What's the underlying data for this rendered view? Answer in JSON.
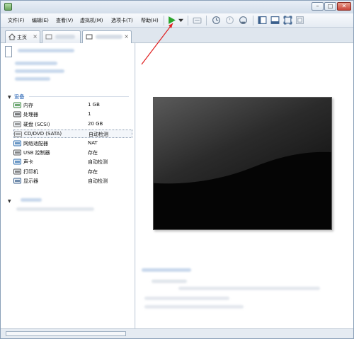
{
  "menu": {
    "items": [
      "文件(F)",
      "编辑(E)",
      "查看(V)",
      "虚拟机(M)",
      "选项卡(T)",
      "帮助(H)"
    ]
  },
  "toolbar": {
    "icons": [
      "play-icon",
      "dropdown-icon",
      "send-keys-icon",
      "snapshot-icon",
      "revert-snapshot-icon",
      "snapshot-manager-icon",
      "console-view-icon",
      "full-screen-icon",
      "unity-icon",
      "fit-window-icon"
    ]
  },
  "tabs": [
    {
      "label": "主页",
      "icon": "home-icon"
    }
  ],
  "devices": {
    "section_title": "设备",
    "items": [
      {
        "name": "内存",
        "value": "1 GB",
        "icon": "memory-icon"
      },
      {
        "name": "处理器",
        "value": "1",
        "icon": "processor-icon"
      },
      {
        "name": "硬盘 (SCSI)",
        "value": "20 GB",
        "icon": "hard-disk-icon"
      },
      {
        "name": "CD/DVD (SATA)",
        "value": "自动检测",
        "icon": "cd-dvd-icon"
      },
      {
        "name": "网络适配器",
        "value": "NAT",
        "icon": "network-adapter-icon"
      },
      {
        "name": "USB 控制器",
        "value": "存在",
        "icon": "usb-icon"
      },
      {
        "name": "声卡",
        "value": "自动检测",
        "icon": "sound-card-icon"
      },
      {
        "name": "打印机",
        "value": "存在",
        "icon": "printer-icon"
      },
      {
        "name": "显示器",
        "value": "自动检测",
        "icon": "display-icon"
      }
    ],
    "selected_index": 3
  },
  "colors": {
    "accent": "#1a5ab0",
    "play_green": "#2aa52a",
    "arrow_red": "#e02020"
  }
}
